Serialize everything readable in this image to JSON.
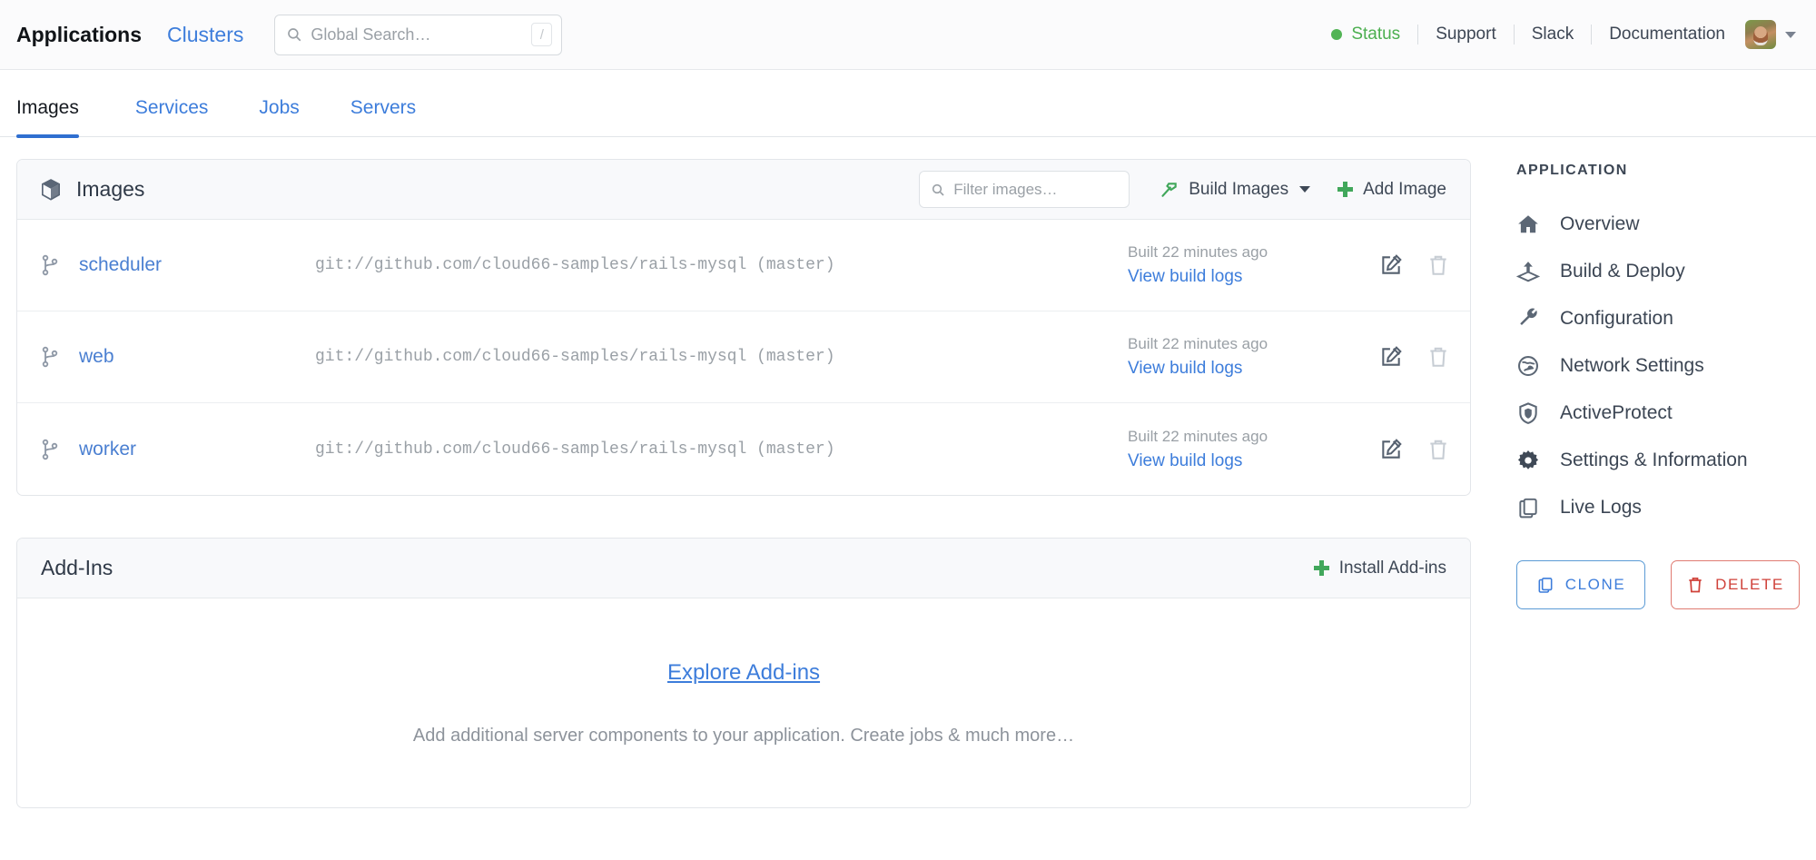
{
  "header": {
    "applications_label": "Applications",
    "clusters_label": "Clusters",
    "search": {
      "placeholder": "Global Search…",
      "shortcut_key": "/",
      "icon": "search-icon"
    },
    "status_label": "Status",
    "status_color": "#4caf50",
    "support_label": "Support",
    "slack_label": "Slack",
    "documentation_label": "Documentation",
    "avatar_alt": "user-avatar"
  },
  "tabs": [
    {
      "label": "Images",
      "active": true
    },
    {
      "label": "Services",
      "active": false
    },
    {
      "label": "Jobs",
      "active": false
    },
    {
      "label": "Servers",
      "active": false
    }
  ],
  "images_panel": {
    "title": "Images",
    "title_icon": "cube-icon",
    "filter_placeholder": "Filter images…",
    "build_button": "Build Images",
    "add_button": "Add Image",
    "rows": [
      {
        "name": "scheduler",
        "repo": "git://github.com/cloud66-samples/rails-mysql (master)",
        "built": "Built 22 minutes ago",
        "logs": "View build logs"
      },
      {
        "name": "web",
        "repo": "git://github.com/cloud66-samples/rails-mysql (master)",
        "built": "Built 22 minutes ago",
        "logs": "View build logs"
      },
      {
        "name": "worker",
        "repo": "git://github.com/cloud66-samples/rails-mysql (master)",
        "built": "Built 22 minutes ago",
        "logs": "View build logs"
      }
    ]
  },
  "addins_panel": {
    "title": "Add-Ins",
    "install_button": "Install Add-ins",
    "explore_link": "Explore Add-ins",
    "description": "Add additional server components to your application. Create jobs & much more…"
  },
  "sidebar": {
    "heading": "APPLICATION",
    "items": [
      {
        "label": "Overview",
        "icon": "home-icon"
      },
      {
        "label": "Build & Deploy",
        "icon": "deploy-icon"
      },
      {
        "label": "Configuration",
        "icon": "wrench-icon"
      },
      {
        "label": "Network Settings",
        "icon": "globe-icon"
      },
      {
        "label": "ActiveProtect",
        "icon": "shield-icon"
      },
      {
        "label": "Settings & Information",
        "icon": "gear-icon"
      },
      {
        "label": "Live Logs",
        "icon": "copy-icon"
      }
    ],
    "clone_button": "CLONE",
    "delete_button": "DELETE",
    "clone_color": "#3d7ddb",
    "delete_color": "#d0423a"
  }
}
